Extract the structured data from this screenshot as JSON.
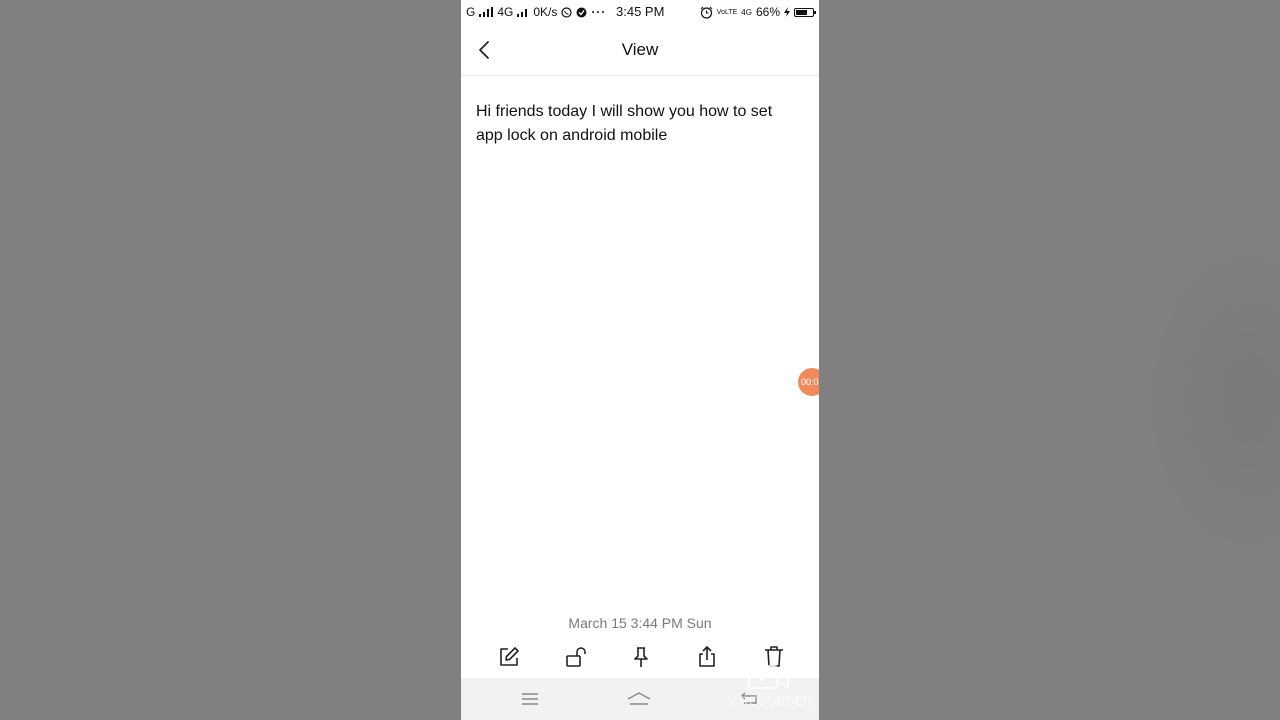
{
  "status_bar": {
    "carrier1": "G",
    "network": "4G",
    "speed": "0K/s",
    "dots": "···",
    "time": "3:45 PM",
    "volte": "VoLTE",
    "net2": "4G",
    "battery_percent": "66%",
    "battery_level": 0.66
  },
  "header": {
    "title": "View"
  },
  "note": {
    "text": "Hi friends today I will show you how to set app lock on android mobile",
    "timestamp": "March 15 3:44 PM Sun"
  },
  "toolbar": {
    "icons": [
      "edit-icon",
      "unlock-icon",
      "pin-icon",
      "share-icon",
      "delete-icon"
    ]
  },
  "nav": {
    "icons": [
      "menu-icon",
      "home-icon",
      "back-nav-icon"
    ]
  },
  "floating": {
    "label": "00:0"
  },
  "watermark": {
    "text": "V RECORDER"
  },
  "colors": {
    "background": "#808080",
    "screen": "#ffffff",
    "bubble": "#f08a5d",
    "timestamp": "#7a7a7a"
  }
}
